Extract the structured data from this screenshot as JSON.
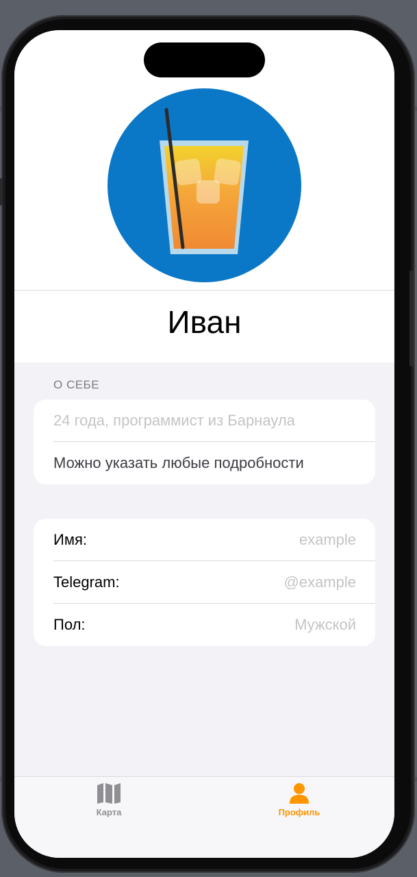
{
  "profile": {
    "name": "Иван",
    "avatar_icon": "tropical-drink-icon"
  },
  "about": {
    "section_title": "О СЕБЕ",
    "placeholder": "24 года, программист из Барнаула",
    "hint": "Можно указать любые подробности"
  },
  "details": {
    "rows": [
      {
        "label": "Имя:",
        "value": "example"
      },
      {
        "label": "Telegram:",
        "value": "@example"
      },
      {
        "label": "Пол:",
        "value": "Мужской"
      }
    ]
  },
  "tab_bar": {
    "items": [
      {
        "label": "Карта",
        "icon": "map-icon",
        "active": false
      },
      {
        "label": "Профиль",
        "icon": "person-icon",
        "active": true
      }
    ],
    "active_color": "#ff9500",
    "inactive_color": "#8e8e93"
  },
  "colors": {
    "avatar_background": "#0a78c7",
    "screen_background": "#f2f2f7"
  }
}
